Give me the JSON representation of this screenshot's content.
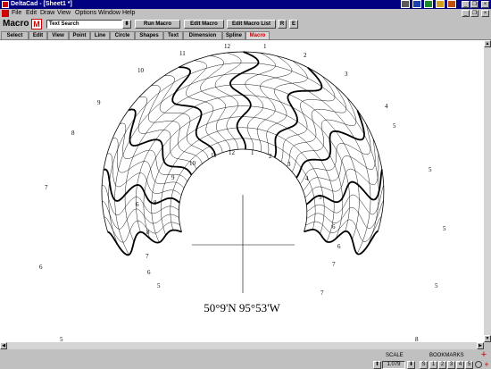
{
  "window": {
    "title": "DeltaCad - [Sheet1 *]"
  },
  "menu": {
    "items": [
      "File",
      "Edit",
      "Draw",
      "View",
      "Options",
      "Window",
      "Help"
    ]
  },
  "toolbar": {
    "label": "Macro",
    "macro_icon": "M",
    "macro_select_value": "Text Search",
    "run_macro": "Run Macro",
    "edit_macro": "Edit Macro",
    "edit_macro_list": "Edit Macro List",
    "r_button": "R",
    "e_button": "E"
  },
  "tabs": [
    "Select",
    "Edit",
    "View",
    "Point",
    "Line",
    "Circle",
    "Shapes",
    "Text",
    "Dimension",
    "Spline",
    "Macro"
  ],
  "active_tab": "Macro",
  "drawing": {
    "coordinate_label": "50°9'N  95°53'W",
    "outer_hours": [
      "12",
      "1",
      "2",
      "3",
      "4",
      "11",
      "10",
      "9",
      "8",
      "7",
      "6",
      "5"
    ],
    "inner_hours": [
      "12",
      "1",
      "2",
      "3",
      "4",
      "5",
      "11",
      "10",
      "9",
      "8"
    ],
    "scatter_labels": [
      "5",
      "5",
      "6",
      "5",
      "6",
      "7",
      "7",
      "8",
      "8",
      "7",
      "6",
      "6",
      "5",
      "5"
    ]
  },
  "status": {
    "scale_label": "SCALE",
    "scale_value": "1.079",
    "bookmarks_label": "BOOKMARKS",
    "bookmarks": [
      "S",
      "1",
      "2",
      "3",
      "4",
      "5"
    ]
  },
  "colors": {
    "titlebar": "#000080",
    "active_tab": "#cc0000",
    "face": "#c0c0c0"
  }
}
